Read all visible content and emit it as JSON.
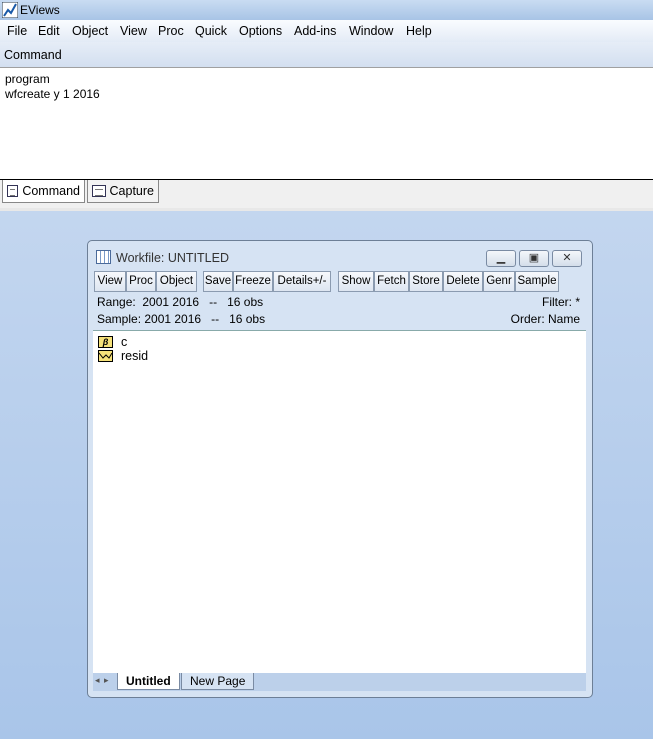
{
  "app": {
    "title": "EViews"
  },
  "menu": [
    "File",
    "Edit",
    "Object",
    "View",
    "Proc",
    "Quick",
    "Options",
    "Add-ins",
    "Window",
    "Help"
  ],
  "command": {
    "label": "Command",
    "lines": [
      "program",
      "wfcreate y 1 2016"
    ]
  },
  "bottom_tabs": [
    "Command",
    "Capture"
  ],
  "workfile": {
    "title": "Workfile: UNTITLED",
    "toolbar": [
      "View",
      "Proc",
      "Object",
      "Save",
      "Freeze",
      "Details+/-",
      "Show",
      "Fetch",
      "Store",
      "Delete",
      "Genr",
      "Sample"
    ],
    "range": "Range:  2001 2016   --   16 obs",
    "sample": "Sample: 2001 2016   --   16 obs",
    "filter": "Filter: *",
    "order": "Order: Name",
    "objects": [
      {
        "name": "c",
        "icon": "coefficient-icon",
        "glyph": "β"
      },
      {
        "name": "resid",
        "icon": "series-icon"
      }
    ],
    "pages": [
      "Untitled",
      "New Page"
    ]
  }
}
